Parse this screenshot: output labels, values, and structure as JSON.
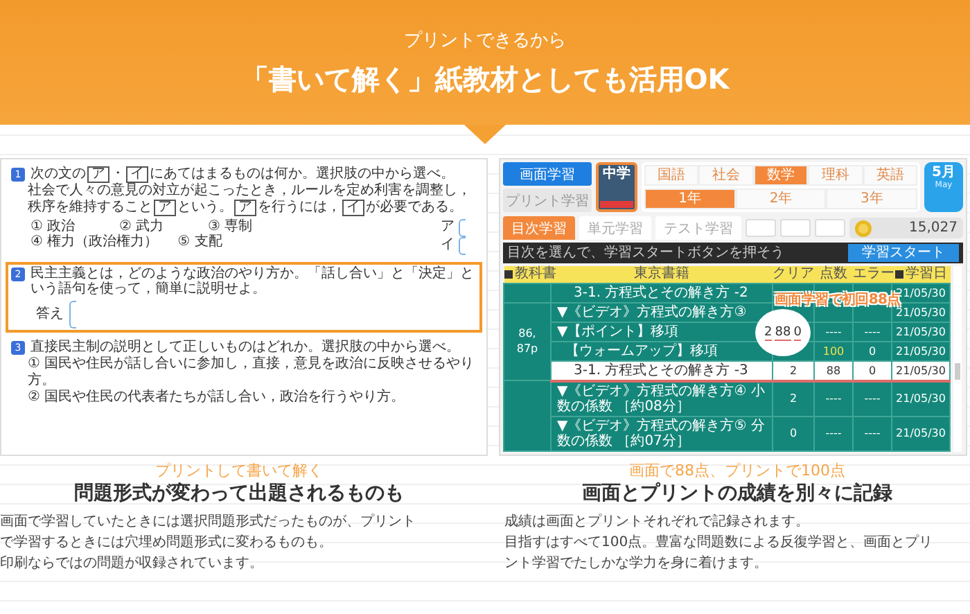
{
  "header": {
    "kicker": "プリントできるから",
    "title": "「書いて解く」紙教材としても活用OK"
  },
  "worksheet": {
    "questions": [
      {
        "kind": "choice",
        "number": "1",
        "selected": false,
        "prompt": [
          {
            "kind": "text",
            "text": "次の文の"
          },
          {
            "kind": "blank",
            "text": "ア"
          },
          {
            "kind": "text",
            "text": "・"
          },
          {
            "kind": "blank",
            "text": "イ"
          },
          {
            "kind": "text",
            "text": "にあてはまるものは何か。選択肢の中から選べ。"
          }
        ],
        "passage": [
          {
            "kind": "text",
            "text": "社会で人々の意見の対立が起こったとき，ルールを定め利害を調整し，秩序を維持すること"
          },
          {
            "kind": "blank",
            "text": "ア"
          },
          {
            "kind": "text",
            "text": "という。"
          },
          {
            "kind": "blank",
            "text": "ア"
          },
          {
            "kind": "text",
            "text": "を行うには，"
          },
          {
            "kind": "blank",
            "text": "イ"
          },
          {
            "kind": "text",
            "text": "が必要である。"
          }
        ],
        "choices": [
          [
            "① 政治",
            "② 武力",
            "③ 専制"
          ],
          [
            "④ 権力（政治権力）",
            "⑤ 支配"
          ]
        ],
        "answers": [
          "ア",
          "イ"
        ]
      },
      {
        "kind": "written",
        "number": "2",
        "selected": true,
        "prompt": "民主主義とは，どのような政治のやり方か。「話し合い」と「決定」という語句を使って，簡単に説明せよ。",
        "answer_label": "答え"
      },
      {
        "kind": "list",
        "number": "3",
        "selected": false,
        "prompt": "直接民主制の説明として正しいものはどれか。選択肢の中から選べ。",
        "options": [
          "① 国民や住民が話し合いに参加し，直接，意見を政治に反映させるやり方。",
          "② 国民や住民の代表者たちが話し合い，政治を行うやり方。"
        ]
      }
    ]
  },
  "app": {
    "modes": [
      {
        "label": "画面学習",
        "selected": true
      },
      {
        "label": "プリント学習",
        "selected": false
      }
    ],
    "thumbnail": {
      "label": "中学"
    },
    "subjects": [
      {
        "label": "国語",
        "selected": false
      },
      {
        "label": "社会",
        "selected": false
      },
      {
        "label": "数学",
        "selected": true
      },
      {
        "label": "理科",
        "selected": false
      },
      {
        "label": "英語",
        "selected": false
      }
    ],
    "grades": [
      {
        "label": "1年",
        "selected": true
      },
      {
        "label": "2年",
        "selected": false
      },
      {
        "label": "3年",
        "selected": false
      }
    ],
    "calendar": {
      "month": "5月",
      "caption": "May"
    },
    "tabs": [
      {
        "label": "目次学習",
        "selected": true
      },
      {
        "label": "単元学習",
        "selected": false
      },
      {
        "label": "テスト学習",
        "selected": false
      }
    ],
    "coins": "15,027",
    "instruction": "目次を選んで、学習スタートボタンを押そう",
    "start_button": "学習スタート",
    "columns": [
      {
        "label": "教科書",
        "sortable": true
      },
      {
        "label": "東京書籍",
        "sortable": false
      },
      {
        "label": "クリア",
        "sortable": false
      },
      {
        "label": "点数",
        "sortable": false
      },
      {
        "label": "エラー",
        "sortable": false
      },
      {
        "label": "学習日",
        "sortable": true
      }
    ],
    "groups": [
      {
        "rows": [
          {
            "kind": "unit",
            "title": "3-1. 方程式とその解き方 -2",
            "clear": "",
            "score": "",
            "error": "",
            "date": "21/05/30",
            "selected": false
          }
        ]
      },
      {
        "page": "86, 87p",
        "rows": [
          {
            "kind": "heading",
            "title": "▼《ビデオ》方程式の解き方③",
            "clear": "",
            "score": "",
            "error": "",
            "date": "21/05/30",
            "selected": false
          },
          {
            "kind": "heading",
            "title": "▼【ポイント】移項",
            "clear": "",
            "score": "----",
            "error": "----",
            "date": "21/05/30",
            "selected": false,
            "perfect": false
          },
          {
            "kind": "step",
            "title": "【ウォームアップ】移項",
            "clear": "",
            "score": "100",
            "error": "0",
            "date": "21/05/30",
            "selected": false,
            "perfect": true
          },
          {
            "kind": "unit",
            "title": "3-1. 方程式とその解き方 -3",
            "clear": "2",
            "score": "88",
            "error": "0",
            "date": "21/05/30",
            "selected": true,
            "perfect": false
          }
        ]
      },
      {
        "rows": [
          {
            "kind": "heading",
            "title": "▼《ビデオ》方程式の解き方④ 小数の係数",
            "duration": "［約08分］",
            "clear": "2",
            "score": "----",
            "error": "----",
            "date": "21/05/30",
            "selected": false,
            "perfect": false
          },
          {
            "kind": "heading",
            "title": "▼《ビデオ》方程式の解き方⑤ 分数の係数",
            "duration": "［約07分］",
            "clear": "0",
            "score": "----",
            "error": "----",
            "date": "21/05/30",
            "selected": false,
            "perfect": false
          }
        ]
      }
    ],
    "callout": {
      "label": "画面学習で初回88点",
      "values": [
        "2",
        "88",
        "0"
      ]
    }
  },
  "features": [
    {
      "kicker": "プリントして書いて解く",
      "heading": "問題形式が変わって出題されるものも",
      "lines": [
        "画面で学習していたときには選択問題形式だったものが、プリント",
        "で学習するときには穴埋め問題形式に変わるものも。",
        "印刷ならではの問題が収録されています。"
      ]
    },
    {
      "kicker": "画面で88点、プリントで100点",
      "heading": "画面とプリントの成績を別々に記録",
      "lines": [
        "成績は画面とプリントそれぞれで記録されます。",
        "目指すはすべて100点。豊富な問題数による反復学習と、画面とプリ",
        "ント学習でたしかな学力を身に着けます。"
      ]
    }
  ]
}
